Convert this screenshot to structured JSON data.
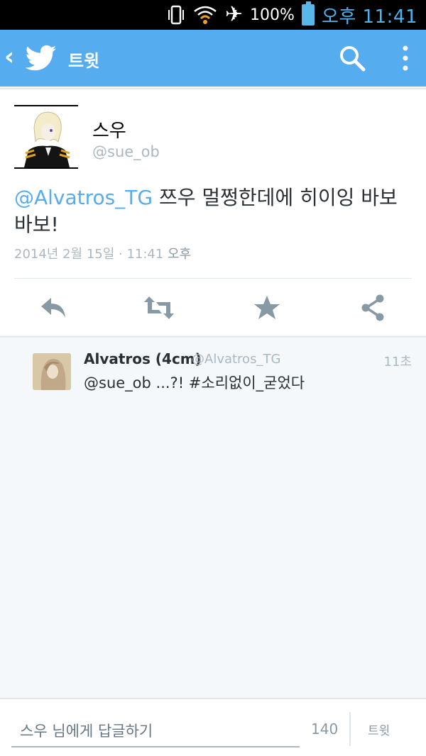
{
  "status_bar": {
    "battery_percent": "100%",
    "time": "오후 11:41",
    "icons": [
      "vibrate-icon",
      "wifi-icon",
      "airplane-mode-icon",
      "battery-charging-icon"
    ],
    "colors": {
      "time": "#4db3ee",
      "battery": "#58b6e8"
    }
  },
  "action_bar": {
    "title": "트윗",
    "color": "#55acee",
    "icons": [
      "back-icon",
      "twitter-bird-icon",
      "search-icon",
      "overflow-menu-icon"
    ]
  },
  "tweet": {
    "display_name": "스우",
    "handle": "@sue_ob",
    "mention": "@Alvatros_TG",
    "text_after_mention": " 쯔우 멀쩡한데에 히이잉 바보바보!",
    "timestamp_date": "2014년 2월 15일 · 11:41",
    "timestamp_ampm": " 오후",
    "actions": [
      "reply-icon",
      "retweet-icon",
      "favorite-icon",
      "share-icon"
    ]
  },
  "reply": {
    "display_name": "Alvatros (4cm)",
    "handle": "@Alvatros_TG",
    "time_ago": "11초",
    "text": "@sue_ob ...?! #소리없이_굳었다"
  },
  "composer": {
    "placeholder": "스우 님에게 답글하기",
    "char_count": "140",
    "send_label": "트윗"
  }
}
